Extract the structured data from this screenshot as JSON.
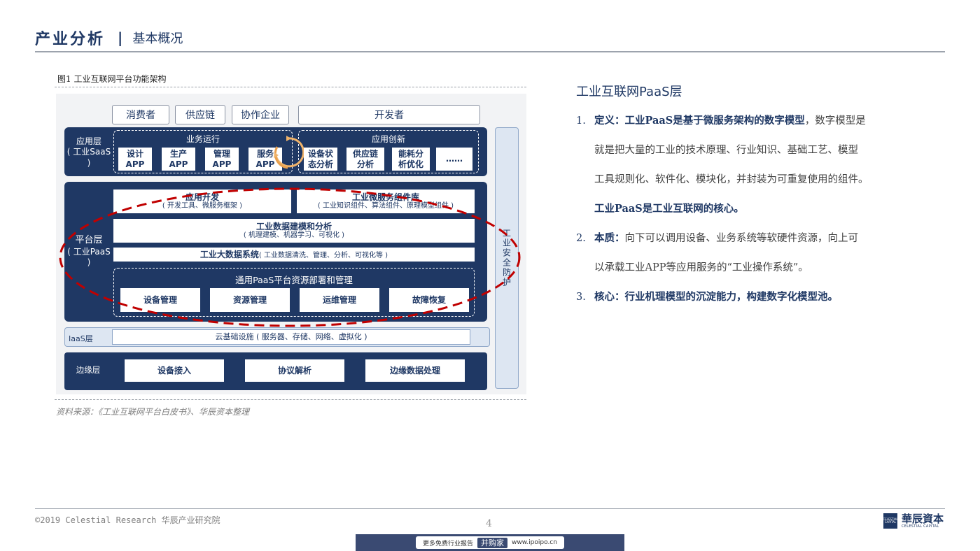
{
  "header": {
    "title": "产业分析",
    "separator": "|",
    "subtitle": "基本概况"
  },
  "figure": {
    "caption": "图1 工业互联网平台功能架构",
    "source": "资料来源：《工业互联网平台白皮书》、华辰资本整理",
    "users": [
      "消费者",
      "供应链",
      "协作企业"
    ],
    "developer": "开发者",
    "saas": {
      "label_line1": "应用层",
      "label_line2": "( 工业SaaS )",
      "business_title": "业务运行",
      "business_apps": [
        {
          "l1": "设计",
          "l2": "APP"
        },
        {
          "l1": "生产",
          "l2": "APP"
        },
        {
          "l1": "管理",
          "l2": "APP"
        },
        {
          "l1": "服务",
          "l2": "APP"
        }
      ],
      "innovation_title": "应用创新",
      "innovation_apps": [
        {
          "l1": "设备状",
          "l2": "态分析"
        },
        {
          "l1": "供应链",
          "l2": "分析"
        },
        {
          "l1": "能耗分",
          "l2": "析优化"
        },
        {
          "l1": "……",
          "l2": ""
        }
      ]
    },
    "paas": {
      "label_line1": "平台层",
      "label_line2": "( 工业PaaS )",
      "app_dev_title": "应用开发",
      "app_dev_sub": "( 开发工具、微服务框架 )",
      "micro_title": "工业微服务组件库",
      "micro_sub": "( 工业知识组件、算法组件、原理模型组件 )",
      "modeling_title": "工业数据建模和分析",
      "modeling_sub": "( 机理建模、机器学习、可视化 )",
      "bigdata_title": "工业大数据系统",
      "bigdata_sub": "( 工业数据清洗、管理、分析、可视化等 )",
      "resource_title": "通用PaaS平台资源部署和管理",
      "resources": [
        "设备管理",
        "资源管理",
        "运维管理",
        "故障恢复"
      ]
    },
    "iaas": {
      "label": "IaaS层",
      "content": "云基础设施 ( 服务器、存储、网络、虚拟化 )"
    },
    "edge": {
      "label": "边缘层",
      "items": [
        "设备接入",
        "协议解析",
        "边缘数据处理"
      ]
    },
    "security": "工业安全防护",
    "colors": {
      "layer": "#1f3864",
      "highlight": "#c00000"
    }
  },
  "right": {
    "title": "工业互联网PaaS层",
    "items": [
      {
        "num": "1.",
        "lead": "定义：",
        "bold": "工业PaaS是基于微服务架构的数字模型",
        "text1": "，数字模型是",
        "line2": "就是把大量的工业的技术原理、行业知识、基础工艺、模型",
        "line3": "工具规则化、软件化、模块化，并封装为可重复使用的组件。",
        "line4": "工业PaaS是工业互联网的核心。"
      },
      {
        "num": "2.",
        "lead": "本质：",
        "text1": "向下可以调用设备、业务系统等软硬件资源，向上可",
        "line2": "以承载工业APP等应用服务的“工业操作系统”。"
      },
      {
        "num": "3.",
        "lead": "核心：",
        "bold": "行业机理模型的沉淀能力，构建数字化模型池。"
      }
    ]
  },
  "footer": {
    "copyright": "©2019 Celestial Research 华辰产业研究院",
    "page": "4",
    "logo_cn": "華辰資本",
    "logo_en": "CELESTIAL CAPITAL",
    "logo_mark": "CELESTIAL CAPITAL",
    "banner_left": "更多免费行业报告",
    "banner_brand": "并购家",
    "banner_url": "www.ipoipo.cn"
  }
}
